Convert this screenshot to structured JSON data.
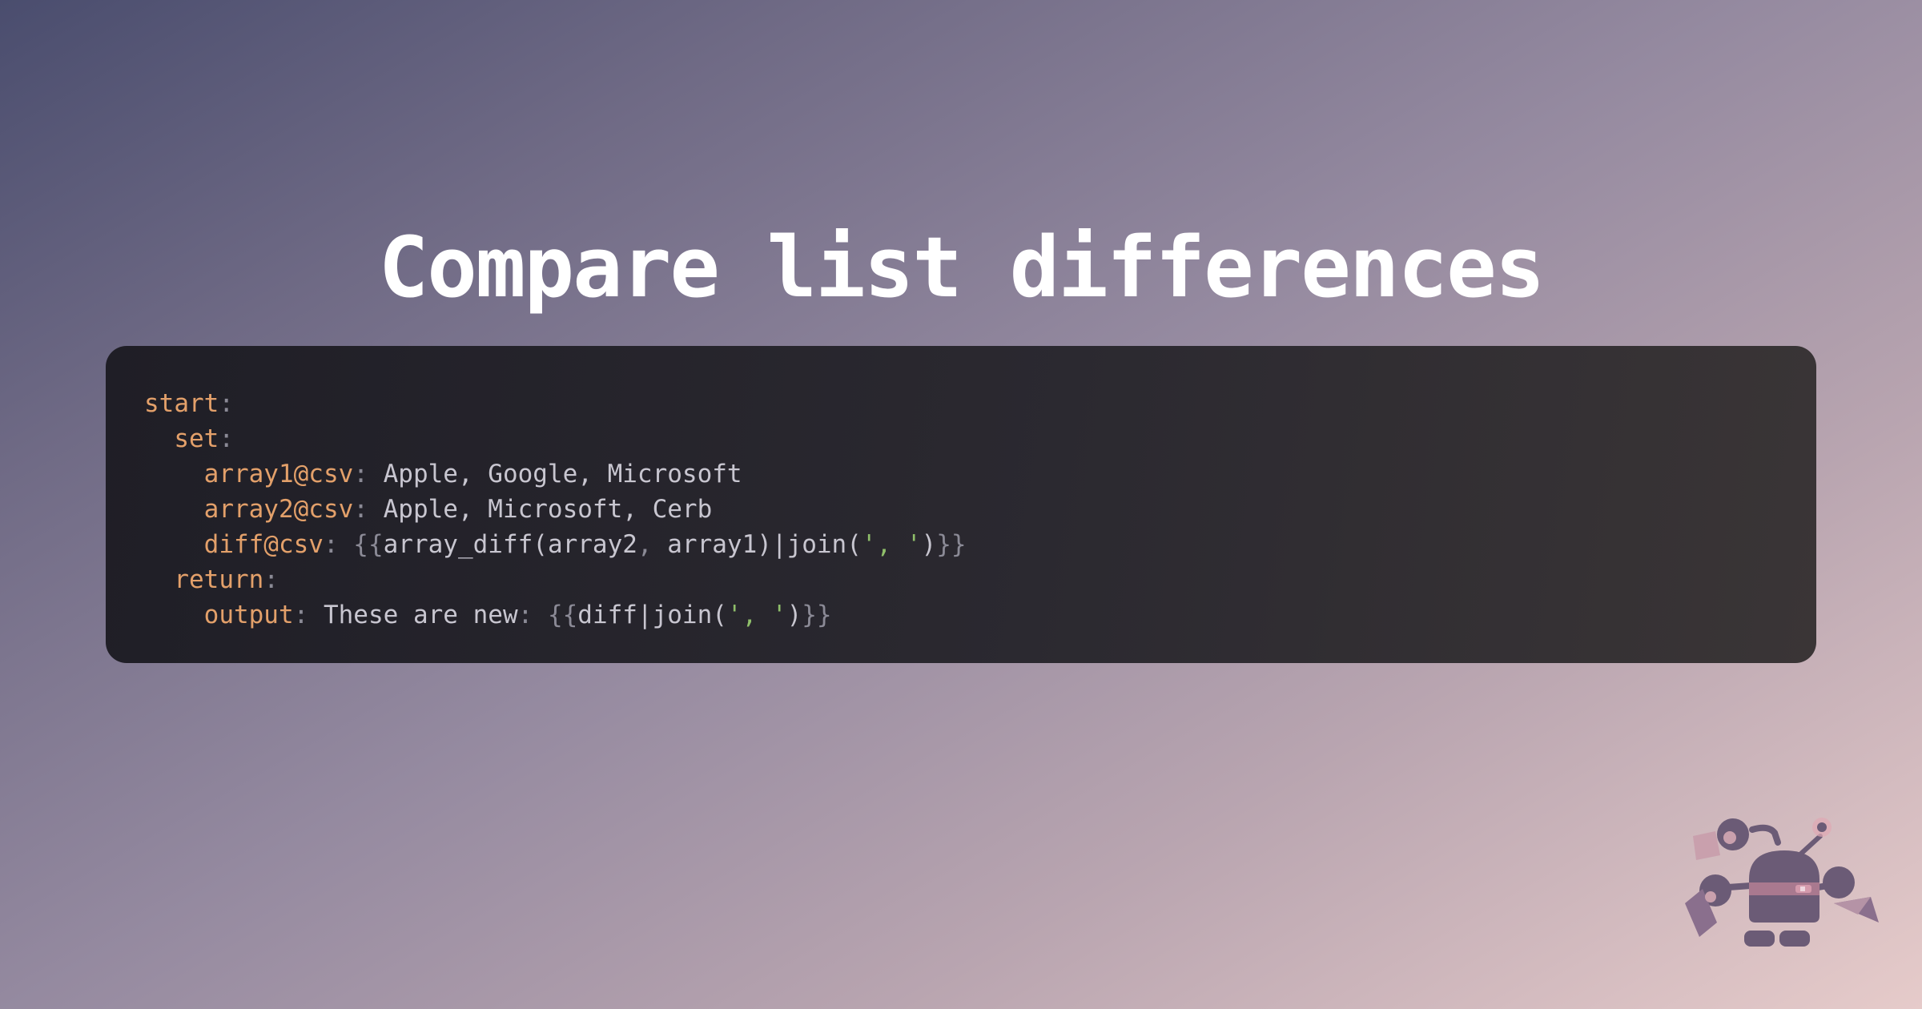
{
  "title": "Compare list differences",
  "code": {
    "line1": {
      "key": "start",
      "colon": ":"
    },
    "line2": {
      "key": "set",
      "colon": ":"
    },
    "line3": {
      "key": "array1@csv",
      "colon": ":",
      "value": " Apple, Google, Microsoft"
    },
    "line4": {
      "key": "array2@csv",
      "colon": ":",
      "value": " Apple, Microsoft, Cerb"
    },
    "line5": {
      "key": "diff@csv",
      "colon": ":",
      "open": " {{",
      "fn": "array_diff(array2",
      "comma": ",",
      "fn2": " array1)|join(",
      "str": "', '",
      "close_paren": ")",
      "close": "}}"
    },
    "line6": {
      "key": "return",
      "colon": ":"
    },
    "line7": {
      "key": "output",
      "colon": ":",
      "value": " These are new",
      "colon2": ":",
      "open": " {{",
      "fn": "diff|join(",
      "str": "', '",
      "close_paren": ")",
      "close": "}}"
    }
  },
  "colors": {
    "key": "#e3a06a",
    "punctuation": "#8b8a96",
    "value": "#c8c6d0",
    "string": "#8fbf6a",
    "panel": "#2b2930"
  },
  "mascot": {
    "icon": "robot-mascot-icon"
  }
}
